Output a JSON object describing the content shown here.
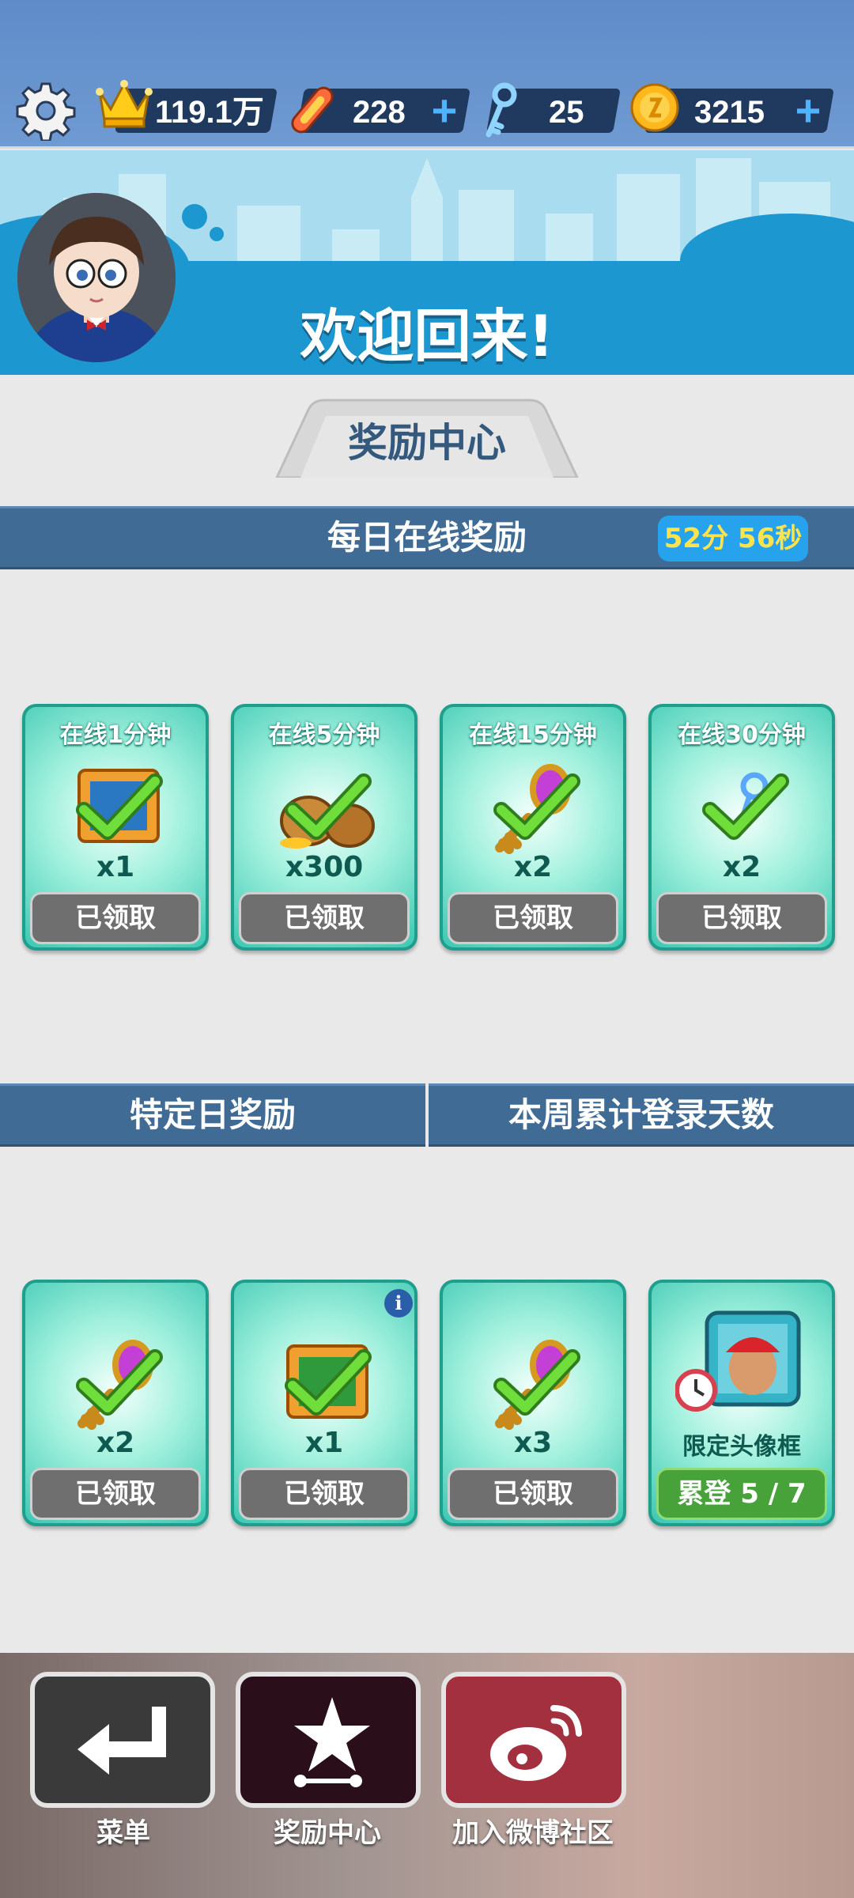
{
  "topbar": {
    "settings_icon": "gear-icon",
    "stats": [
      {
        "icon": "crown-icon",
        "value": "119.1万"
      },
      {
        "icon": "hoverboard-icon",
        "value": "228"
      },
      {
        "icon": "key-icon",
        "value": "25"
      },
      {
        "icon": "coin-icon",
        "value": "3215"
      }
    ]
  },
  "banner": {
    "welcome": "欢迎回来!"
  },
  "reward_tab": {
    "title": "奖励中心"
  },
  "daily_online": {
    "title": "每日在线奖励",
    "timer": "52分 56秒",
    "cards": [
      {
        "title": "在线1分钟",
        "item": "mystery-box-icon",
        "qty": "x1",
        "button": "已领取"
      },
      {
        "title": "在线5分钟",
        "item": "money-bag-icon",
        "qty": "x300",
        "button": "已领取"
      },
      {
        "title": "在线15分钟",
        "item": "key-icon",
        "qty": "x2",
        "button": "已领取"
      },
      {
        "title": "在线30分钟",
        "item": "key-icon",
        "qty": "x2",
        "button": "已领取"
      }
    ]
  },
  "special_day": {
    "title": "特定日奖励",
    "week_title": "本周累计登录天数",
    "cards": [
      {
        "item": "key-icon",
        "qty": "x2",
        "button": "已领取"
      },
      {
        "item": "mystery-box-icon",
        "qty": "x1",
        "button": "已领取",
        "info": "i"
      },
      {
        "item": "key-icon",
        "qty": "x3",
        "button": "已领取"
      },
      {
        "item": "avatar-frame-icon",
        "qty": "限定头像框",
        "button": "累登 5 / 7"
      }
    ]
  },
  "bottom_nav": [
    {
      "icon": "return-arrow-icon",
      "label": "菜单"
    },
    {
      "icon": "star-trophy-icon",
      "label": "奖励中心"
    },
    {
      "icon": "weibo-icon",
      "label": "加入微博社区"
    }
  ],
  "colors": {
    "topbar": "#6f9ad2",
    "section_bar": "#3f6b95",
    "card_teal": "#3cc7b3",
    "claimed_gray": "#6f6f6f",
    "progress_green": "#48a23a",
    "timer_blue": "#27a3ee"
  }
}
